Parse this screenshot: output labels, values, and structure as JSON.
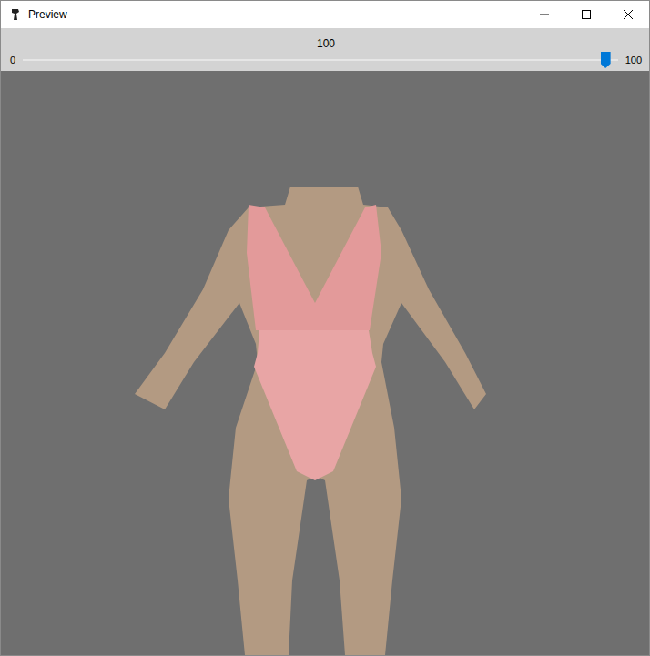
{
  "window": {
    "title": "Preview"
  },
  "slider": {
    "value": "100",
    "min": "0",
    "max": "100",
    "level": 1.0
  }
}
